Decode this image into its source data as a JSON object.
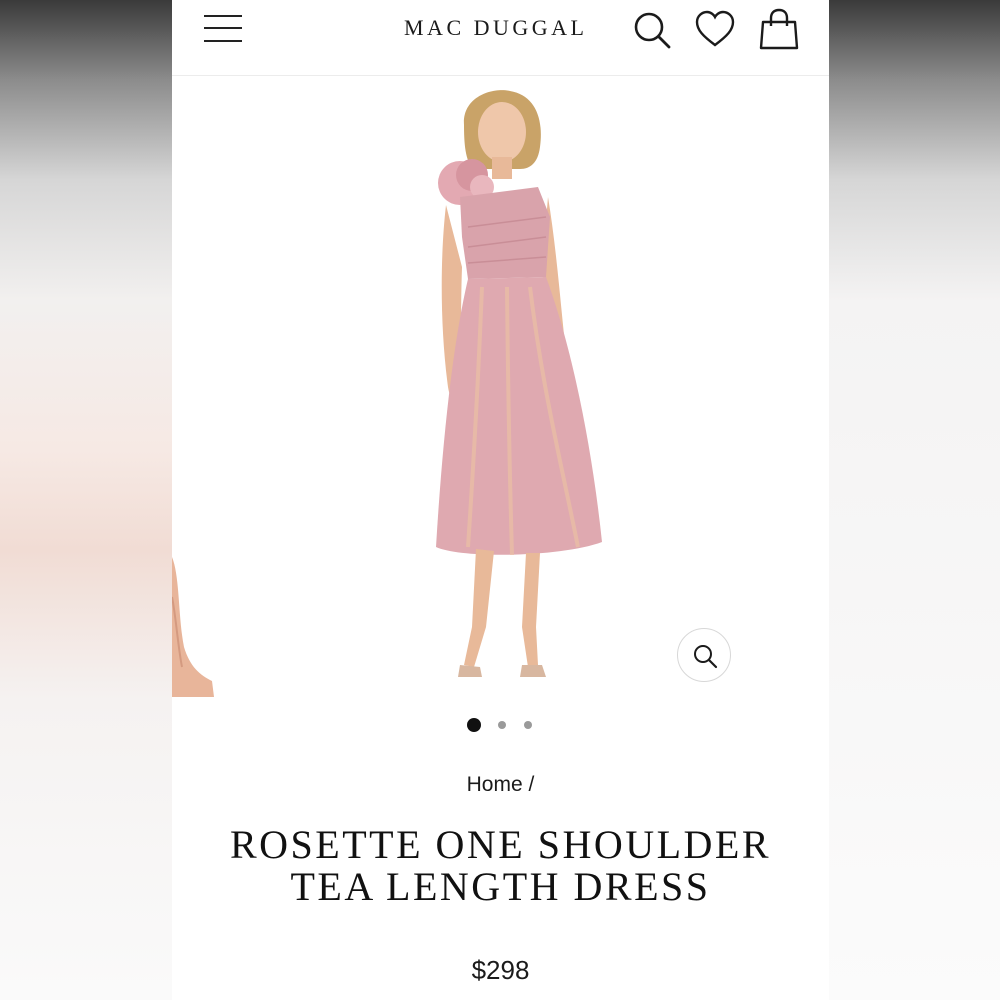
{
  "header": {
    "logo": "MAC DUGGAL",
    "menu_icon": "hamburger-menu-icon",
    "search_icon": "search-icon",
    "wishlist_icon": "heart-icon",
    "cart_icon": "shopping-bag-icon"
  },
  "gallery": {
    "slide_count": 3,
    "active_slide": 1,
    "zoom_icon": "zoom-icon",
    "dress_color": "#d9a3ab"
  },
  "breadcrumb": {
    "home": "Home",
    "separator": "/"
  },
  "product": {
    "title_line1": "ROSETTE ONE SHOULDER",
    "title_line2": "TEA LENGTH DRESS",
    "price": "$298"
  }
}
